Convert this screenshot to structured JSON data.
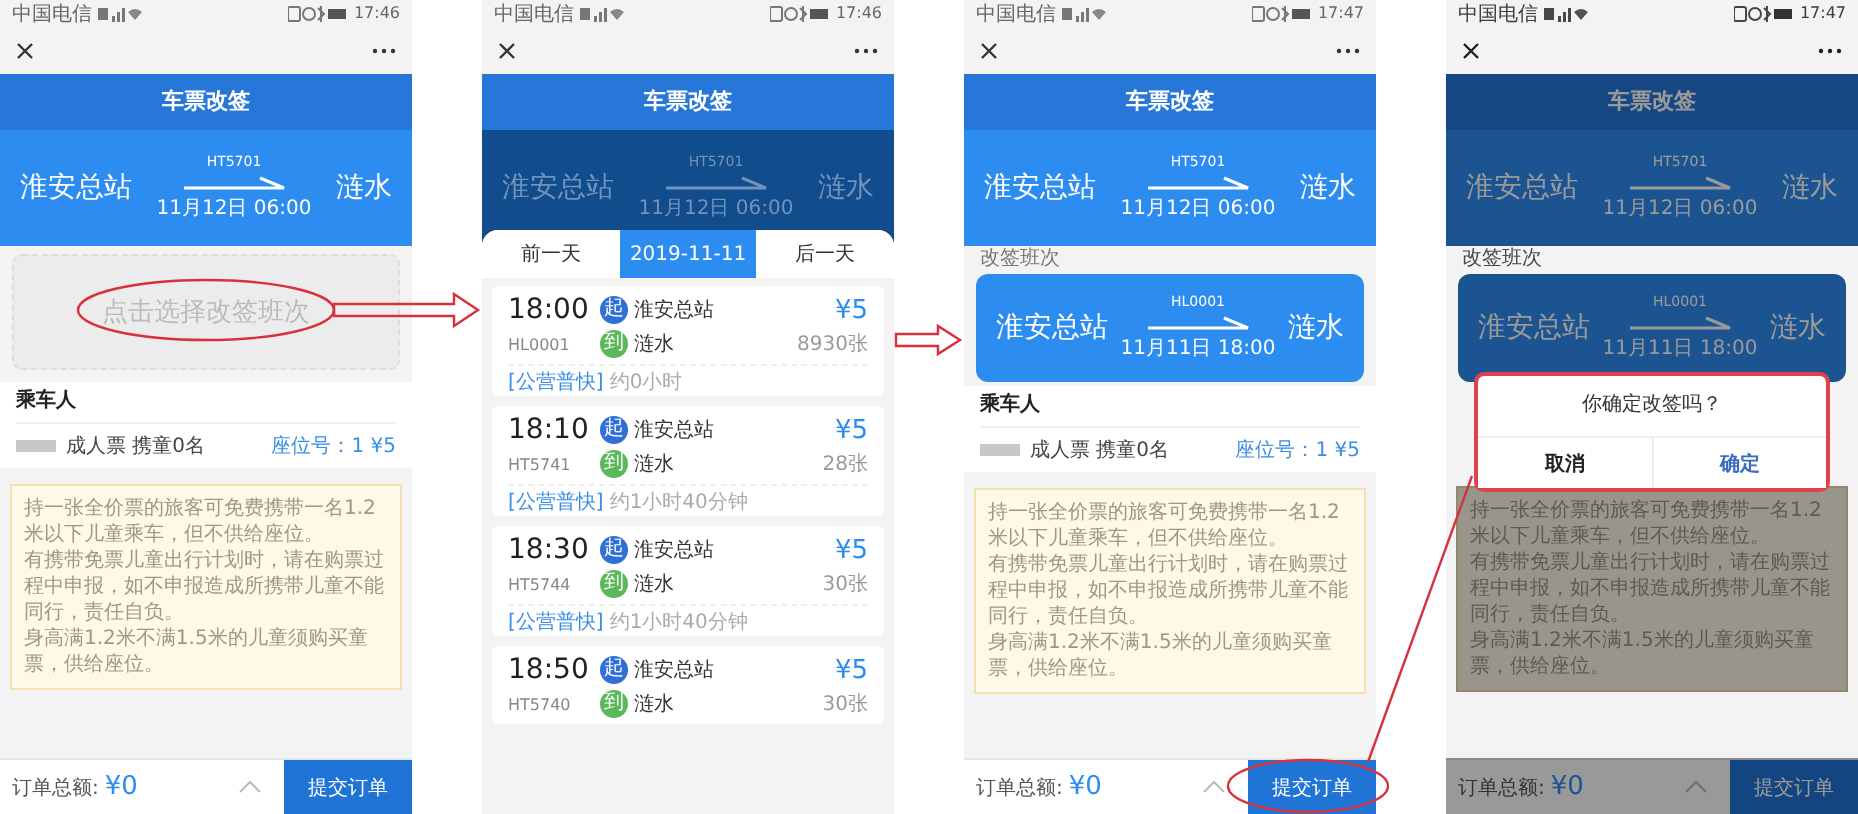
{
  "screens": [
    {
      "dimmed": false,
      "status": {
        "carrier": "中国电信",
        "time": "17:46"
      },
      "title": "车票改签",
      "route": {
        "train": "HT5701",
        "from": "淮安总站",
        "to": "涟水",
        "datetime": "11月12日 06:00",
        "dimmed": false
      },
      "picker": {
        "placeholder": "点击选择改签班次"
      },
      "passenger": {
        "label": "乘车人",
        "ticket": "成人票 携童0名",
        "seat": "座位号：1 ¥5"
      },
      "notice": [
        "持一张全价票的旅客可免费携带一名1.2米以下儿童乘车，但不供给座位。",
        "有携带免票儿童出行计划时，请在购票过程中申报，如不申报造成所携带儿童不能同行，责任自负。",
        "身高满1.2米不满1.5米的儿童须购买童票，供给座位。"
      ],
      "footer": {
        "total_label": "订单总额:",
        "total": "¥0",
        "submit": "提交订单"
      }
    },
    {
      "dimmed": false,
      "status": {
        "carrier": "中国电信",
        "time": "17:46"
      },
      "title": "车票改签",
      "route": {
        "train": "HT5701",
        "from": "淮安总站",
        "to": "涟水",
        "datetime": "11月12日 06:00",
        "dimmed": true
      },
      "sheet": {
        "days": [
          {
            "label": "前一天",
            "selected": false
          },
          {
            "label": "2019-11-11",
            "selected": true
          },
          {
            "label": "后一天",
            "selected": false
          }
        ],
        "trains": [
          {
            "time": "18:00",
            "train": "HL0001",
            "from_mark": "起",
            "from": "淮安总站",
            "to_mark": "到",
            "to": "涟水",
            "price": "¥5",
            "seats": "8930张",
            "tag": "[公营普快]",
            "duration": "约0小时"
          },
          {
            "time": "18:10",
            "train": "HT5741",
            "from_mark": "起",
            "from": "淮安总站",
            "to_mark": "到",
            "to": "涟水",
            "price": "¥5",
            "seats": "28张",
            "tag": "[公营普快]",
            "duration": "约1小时40分钟"
          },
          {
            "time": "18:30",
            "train": "HT5744",
            "from_mark": "起",
            "from": "淮安总站",
            "to_mark": "到",
            "to": "涟水",
            "price": "¥5",
            "seats": "30张",
            "tag": "[公营普快]",
            "duration": "约1小时40分钟"
          },
          {
            "time": "18:50",
            "train": "HT5740",
            "from_mark": "起",
            "from": "淮安总站",
            "to_mark": "到",
            "to": "涟水",
            "price": "¥5",
            "seats": "30张"
          }
        ]
      }
    },
    {
      "dimmed": false,
      "status": {
        "carrier": "中国电信",
        "time": "17:47"
      },
      "title": "车票改签",
      "route": {
        "train": "HT5701",
        "from": "淮安总站",
        "to": "涟水",
        "datetime": "11月12日 06:00",
        "dimmed": false
      },
      "selected_label": "改签班次",
      "selected_trip": {
        "train": "HL0001",
        "from": "淮安总站",
        "to": "涟水",
        "datetime": "11月11日 18:00"
      },
      "passenger": {
        "label": "乘车人",
        "ticket": "成人票 携童0名",
        "seat": "座位号：1 ¥5"
      },
      "notice": [
        "持一张全价票的旅客可免费携带一名1.2米以下儿童乘车，但不供给座位。",
        "有携带免票儿童出行计划时，请在购票过程中申报，如不申报造成所携带儿童不能同行，责任自负。",
        "身高满1.2米不满1.5米的儿童须购买童票，供给座位。"
      ],
      "footer": {
        "total_label": "订单总额:",
        "total": "¥0",
        "submit": "提交订单"
      }
    },
    {
      "dimmed": true,
      "status": {
        "carrier": "中国电信",
        "time": "17:47"
      },
      "title": "车票改签",
      "route": {
        "train": "HT5701",
        "from": "淮安总站",
        "to": "涟水",
        "datetime": "11月12日 06:00",
        "dimmed": false
      },
      "selected_label": "改签班次",
      "selected_trip": {
        "train": "HL0001",
        "from": "淮安总站",
        "to": "涟水",
        "datetime": "11月11日 18:00"
      },
      "notice": [
        "持一张全价票的旅客可免费携带一名1.2米以下儿童乘车，但不供给座位。",
        "有携带免票儿童出行计划时，请在购票过程中申报，如不申报造成所携带儿童不能同行，责任自负。",
        "身高满1.2米不满1.5米的儿童须购买童票，供给座位。"
      ],
      "footer": {
        "total_label": "订单总额:",
        "total": "¥0",
        "submit": "提交订单"
      },
      "dialog": {
        "message": "你确定改签吗？",
        "cancel": "取消",
        "confirm": "确定"
      }
    }
  ]
}
